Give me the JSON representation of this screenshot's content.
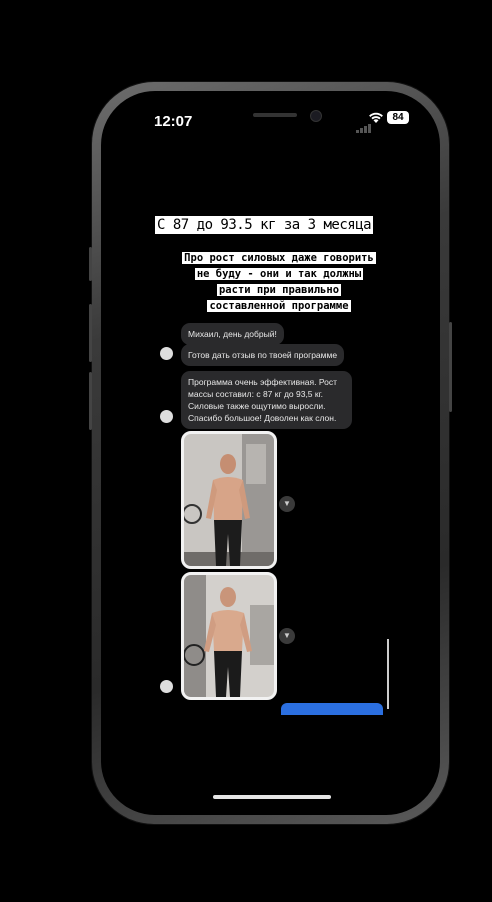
{
  "status_bar": {
    "time": "12:07",
    "battery": "84"
  },
  "story": {
    "headline": "С 87 до 93.5 кг за 3 месяца",
    "subhead": "Про рост силовых даже говорить не буду - они и так должны расти при правильно составленной программе"
  },
  "chat": {
    "messages": [
      "Михаил, день добрый!",
      "Готов дать отзыв по твоей программе",
      "Программа очень эффективная. Рост массы составил: с 87 кг до 93,5 кг. Силовые также ощутимо выросли. Спасибо большое! Доволен как слон."
    ]
  },
  "icons": {
    "share": "share-icon",
    "wifi": "wifi-icon",
    "signal": "signal-icon",
    "battery": "battery-icon"
  },
  "colors": {
    "background": "#000000",
    "bubble": "#2a2a2c",
    "accent": "#2b6fe0"
  }
}
